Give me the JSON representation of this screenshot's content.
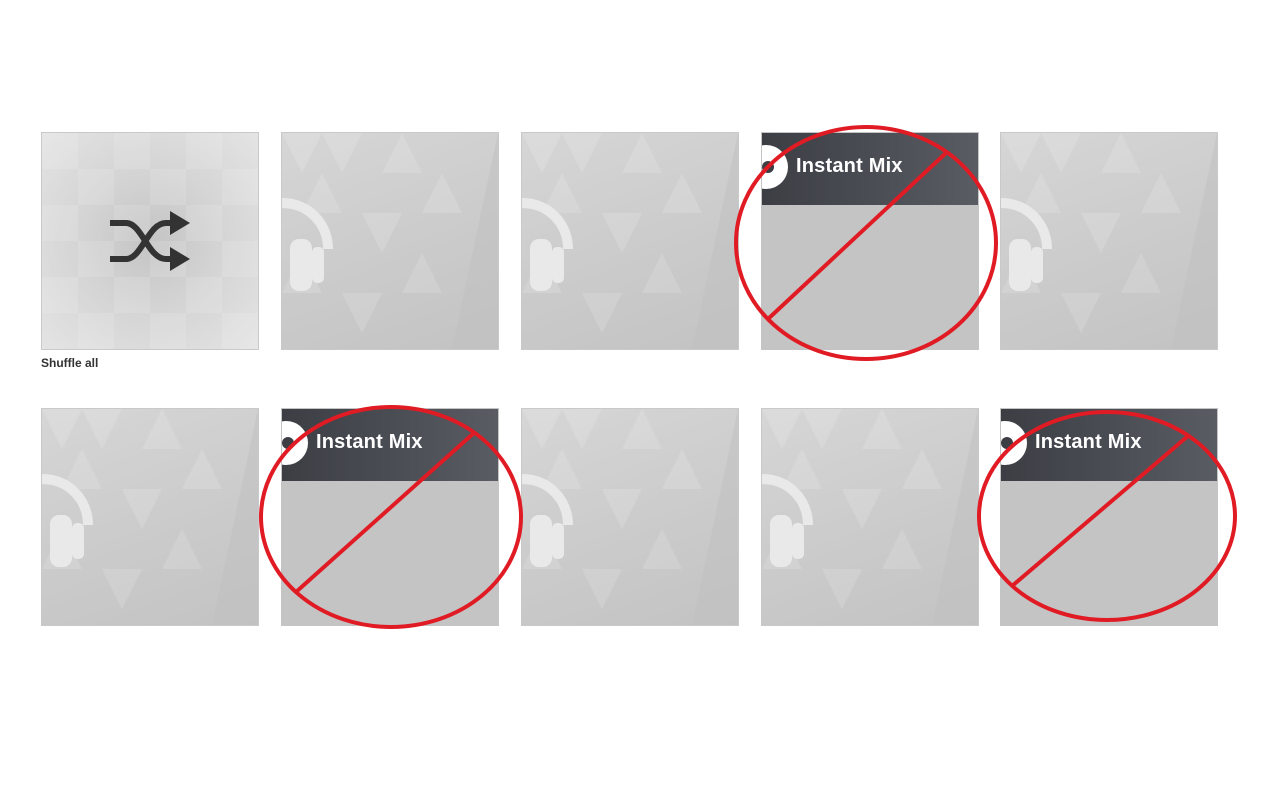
{
  "grid": {
    "shuffle_tile": {
      "label": "Shuffle all",
      "icon": "shuffle-icon"
    },
    "instant_mix_label": "Instant Mix",
    "placeholder_icon": "headphones-icon",
    "tiles": [
      {
        "kind": "shuffle"
      },
      {
        "kind": "placeholder"
      },
      {
        "kind": "placeholder"
      },
      {
        "kind": "instant-mix",
        "crossed_out": true
      },
      {
        "kind": "placeholder"
      },
      {
        "kind": "placeholder"
      },
      {
        "kind": "instant-mix",
        "crossed_out": true
      },
      {
        "kind": "placeholder"
      },
      {
        "kind": "placeholder"
      },
      {
        "kind": "instant-mix",
        "crossed_out": true
      }
    ]
  },
  "annotation": {
    "mark": "prohibition-sign",
    "color": "#e01b24"
  }
}
